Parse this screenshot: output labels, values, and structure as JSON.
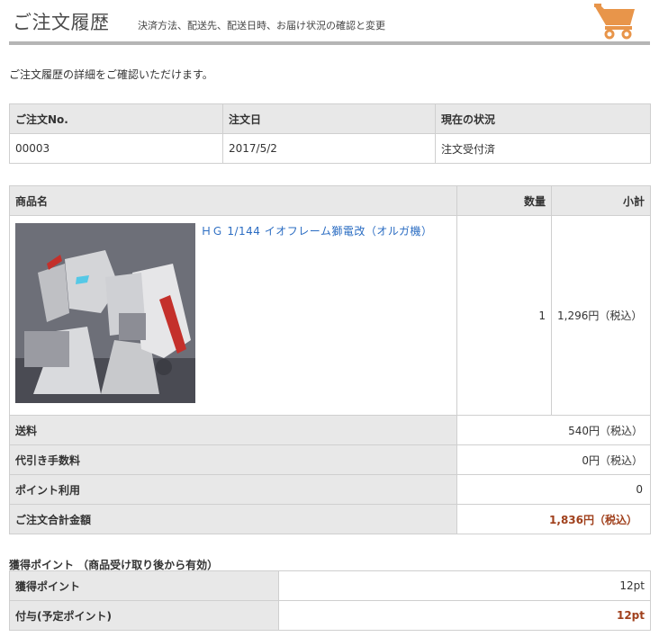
{
  "header": {
    "title": "ご注文履歴",
    "subtitle": "決済方法、配送先、配送日時、お届け状況の確認と変更",
    "cart_icon_color": "#e8954a"
  },
  "intro": "ご注文履歴の詳細をご確認いただけます。",
  "order_table": {
    "headers": [
      "ご注文No.",
      "注文日",
      "現在の状況"
    ],
    "row": [
      "00003",
      "2017/5/2",
      "注文受付済"
    ]
  },
  "items_table": {
    "headers": [
      "商品名",
      "数量",
      "小計"
    ],
    "items": [
      {
        "name": "ＨＧ 1/144 イオフレーム獅電改（オルガ機）",
        "qty": "1",
        "subtotal": "1,296円（税込）"
      }
    ],
    "summary": [
      {
        "label": "送料",
        "value": "540円（税込）"
      },
      {
        "label": "代引き手数料",
        "value": "0円（税込）"
      },
      {
        "label": "ポイント利用",
        "value": "0"
      }
    ],
    "total": {
      "label": "ご注文合計金額",
      "value": "1,836円（税込）"
    }
  },
  "points": {
    "heading": "獲得ポイント （商品受け取り後から有効）",
    "rows": [
      {
        "label": "獲得ポイント",
        "value": "12pt"
      },
      {
        "label": "付与(予定ポイント)",
        "value": "12pt"
      }
    ]
  }
}
